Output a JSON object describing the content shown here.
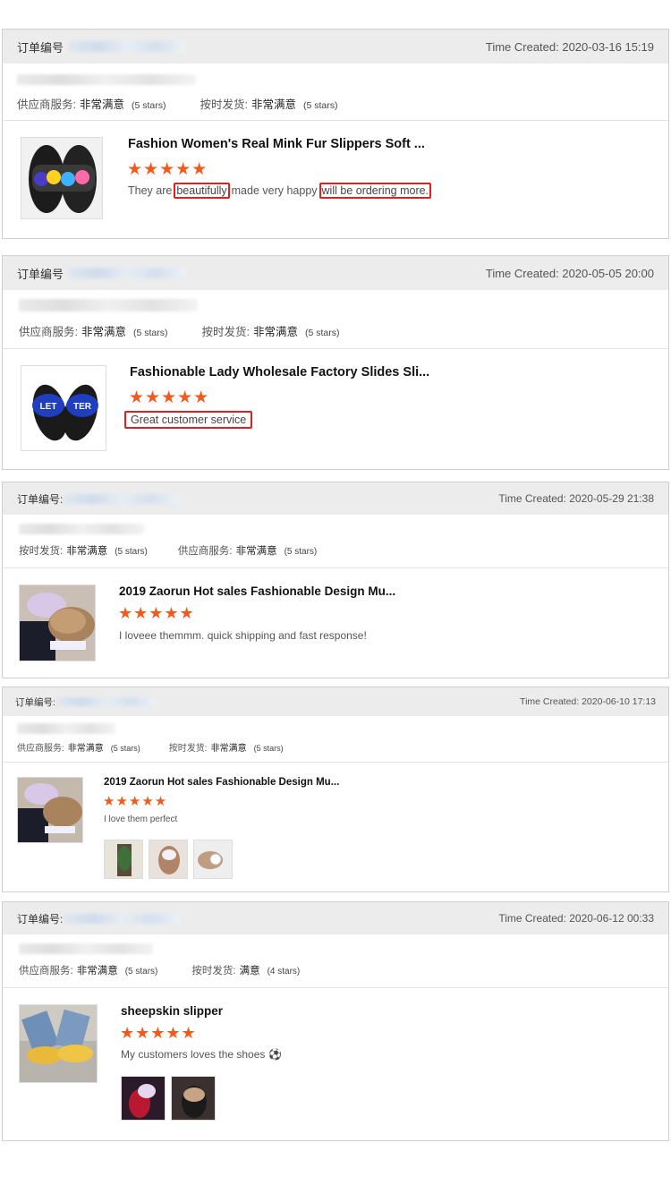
{
  "labels": {
    "order_label": "订单编号",
    "order_label_colon": "订单编号:",
    "time_prefix": "Time Created:"
  },
  "reviews": [
    {
      "time": "Time Created: 2020-03-16 15:19",
      "rating_a": {
        "name": "供应商服务:",
        "level": "非常满意",
        "stars": "(5 stars)"
      },
      "rating_b": {
        "name": "按时发货:",
        "level": "非常满意",
        "stars": "(5 stars)"
      },
      "product_title": "Fashion Women's Real Mink Fur Slippers Soft ...",
      "stars": "★★★★★",
      "comment_parts": [
        "They are",
        "beautifully",
        "made very happy",
        "will be ordering more."
      ]
    },
    {
      "time": "Time Created: 2020-05-05 20:00",
      "rating_a": {
        "name": "供应商服务:",
        "level": "非常满意",
        "stars": "(5 stars)"
      },
      "rating_b": {
        "name": "按时发货:",
        "level": "非常满意",
        "stars": "(5 stars)"
      },
      "product_title": "Fashionable Lady Wholesale Factory Slides Sli...",
      "stars": "★★★★★",
      "comment": "Great customer service",
      "thumb_text": [
        "LET",
        "TER"
      ]
    },
    {
      "time": "Time Created: 2020-05-29 21:38",
      "rating_a": {
        "name": "按时发货:",
        "level": "非常满意",
        "stars": "(5 stars)"
      },
      "rating_b": {
        "name": "供应商服务:",
        "level": "非常满意",
        "stars": "(5 stars)"
      },
      "product_title": "2019 Zaorun Hot sales Fashionable Design Mu...",
      "stars": "★★★★★",
      "comment": "I loveee themmm. quick shipping and fast response!"
    },
    {
      "time": "Time Created: 2020-06-10 17:13",
      "rating_a": {
        "name": "供应商服务:",
        "level": "非常满意",
        "stars": "(5 stars)"
      },
      "rating_b": {
        "name": "按时发货:",
        "level": "非常满意",
        "stars": "(5 stars)"
      },
      "product_title": "2019 Zaorun Hot sales Fashionable Design Mu...",
      "stars": "★★★★★",
      "comment": "I love them perfect"
    },
    {
      "time": "Time Created: 2020-06-12 00:33",
      "rating_a": {
        "name": "供应商服务:",
        "level": "非常满意",
        "stars": "(5 stars)"
      },
      "rating_b": {
        "name": "按时发货:",
        "level": "满意",
        "stars": "(4 stars)"
      },
      "product_title": "sheepskin slipper",
      "stars": "★★★★★",
      "comment": "My customers loves the shoes",
      "comment_emoji": "⚽"
    }
  ],
  "colors": {
    "star": "#f25a1c",
    "highlight_border": "#e02020",
    "header_bg": "#ececec"
  }
}
